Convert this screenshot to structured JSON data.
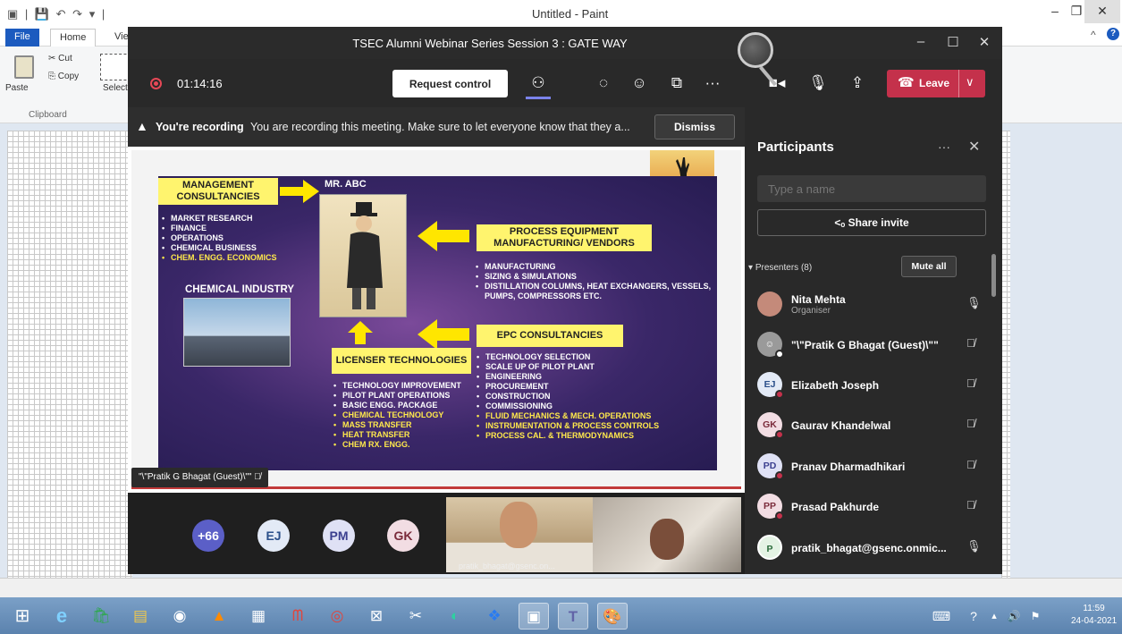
{
  "paint": {
    "title": "Untitled - Paint",
    "tabs": [
      "File",
      "Home",
      "View"
    ],
    "ribbon": {
      "paste": "Paste",
      "cut": "Cut",
      "copy": "Copy",
      "select": "Select",
      "group": "Clipboard"
    }
  },
  "teams": {
    "window_title": "TSEC Alumni Webinar Series Session 3 : GATE WAY",
    "timer": "01:14:16",
    "request_control": "Request control",
    "leave": "Leave",
    "banner": {
      "bold": "You're recording",
      "message": "You are recording this meeting. Make sure to let everyone know that they a...",
      "dismiss": "Dismiss"
    },
    "slide": {
      "mgmt_label": "MANAGEMENT CONSULTANCIES",
      "mgmt_items": [
        "MARKET RESEARCH",
        "FINANCE",
        "OPERATIONS",
        "CHEMICAL BUSINESS"
      ],
      "mgmt_highlight": "CHEM. ENGG. ECONOMICS",
      "mr_abc": "MR. ABC",
      "chem_industry": "CHEMICAL INDUSTRY",
      "process_label": "PROCESS EQUIPMENT MANUFACTURING/ VENDORS",
      "process_items": [
        "MANUFACTURING",
        "SIZING & SIMULATIONS",
        "DISTILLATION COLUMNS, HEAT EXCHANGERS, VESSELS, PUMPS, COMPRESSORS ETC."
      ],
      "epc_label": "EPC CONSULTANCIES",
      "epc_items": [
        "TECHNOLOGY SELECTION",
        "SCALE UP OF PILOT PLANT",
        "ENGINEERING",
        "PROCUREMENT",
        "CONSTRUCTION",
        "COMMISSIONING"
      ],
      "epc_highlight": [
        "FLUID MECHANICS & MECH. OPERATIONS",
        "INSTRUMENTATION & PROCESS CONTROLS",
        "PROCESS CAL. & THERMODYNAMICS"
      ],
      "licenser_label": "LICENSER TECHNOLOGIES",
      "licenser_items": [
        "TECHNOLOGY IMPROVEMENT",
        "PILOT PLANT OPERATIONS",
        "BASIC ENGG. PACKAGE"
      ],
      "licenser_highlight": [
        "CHEMICAL TECHNOLOGY",
        "MASS TRANSFER",
        "HEAT TRANSFER",
        "CHEM RX. ENGG."
      ]
    },
    "presenter_tag": "\"\\\"Pratik G Bhagat (Guest)\\\"\"",
    "gallery": {
      "avatars": [
        {
          "text": "+66",
          "color": "#5b5fc7"
        },
        {
          "text": "EJ",
          "color": "#e3eaf6"
        },
        {
          "text": "PM",
          "color": "#dfe1f5"
        },
        {
          "text": "GK",
          "color": "#f2dde3"
        }
      ],
      "video_caption": "pratik_bhagat@gsenc.on..."
    },
    "participants": {
      "title": "Participants",
      "search_placeholder": "Type a name",
      "share_invite": "Share invite",
      "section": "Presenters (8)",
      "mute_all": "Mute all",
      "list": [
        {
          "initials": "",
          "name": "Nita Mehta",
          "role": "Organiser",
          "muted": false
        },
        {
          "initials": "",
          "name": "\"\\\"Pratik G Bhagat (Guest)\\\"\"",
          "role": "",
          "muted": true
        },
        {
          "initials": "EJ",
          "name": "Elizabeth Joseph",
          "role": "",
          "muted": true
        },
        {
          "initials": "GK",
          "name": "Gaurav Khandelwal",
          "role": "",
          "muted": true
        },
        {
          "initials": "PD",
          "name": "Pranav Dharmadhikari",
          "role": "",
          "muted": true
        },
        {
          "initials": "PP",
          "name": "Prasad Pakhurde",
          "role": "",
          "muted": true
        },
        {
          "initials": "P",
          "name": "pratik_bhagat@gsenc.onmic...",
          "role": "",
          "muted": false
        }
      ]
    }
  },
  "taskbar": {
    "time": "11:59",
    "date": "24-04-2021"
  }
}
